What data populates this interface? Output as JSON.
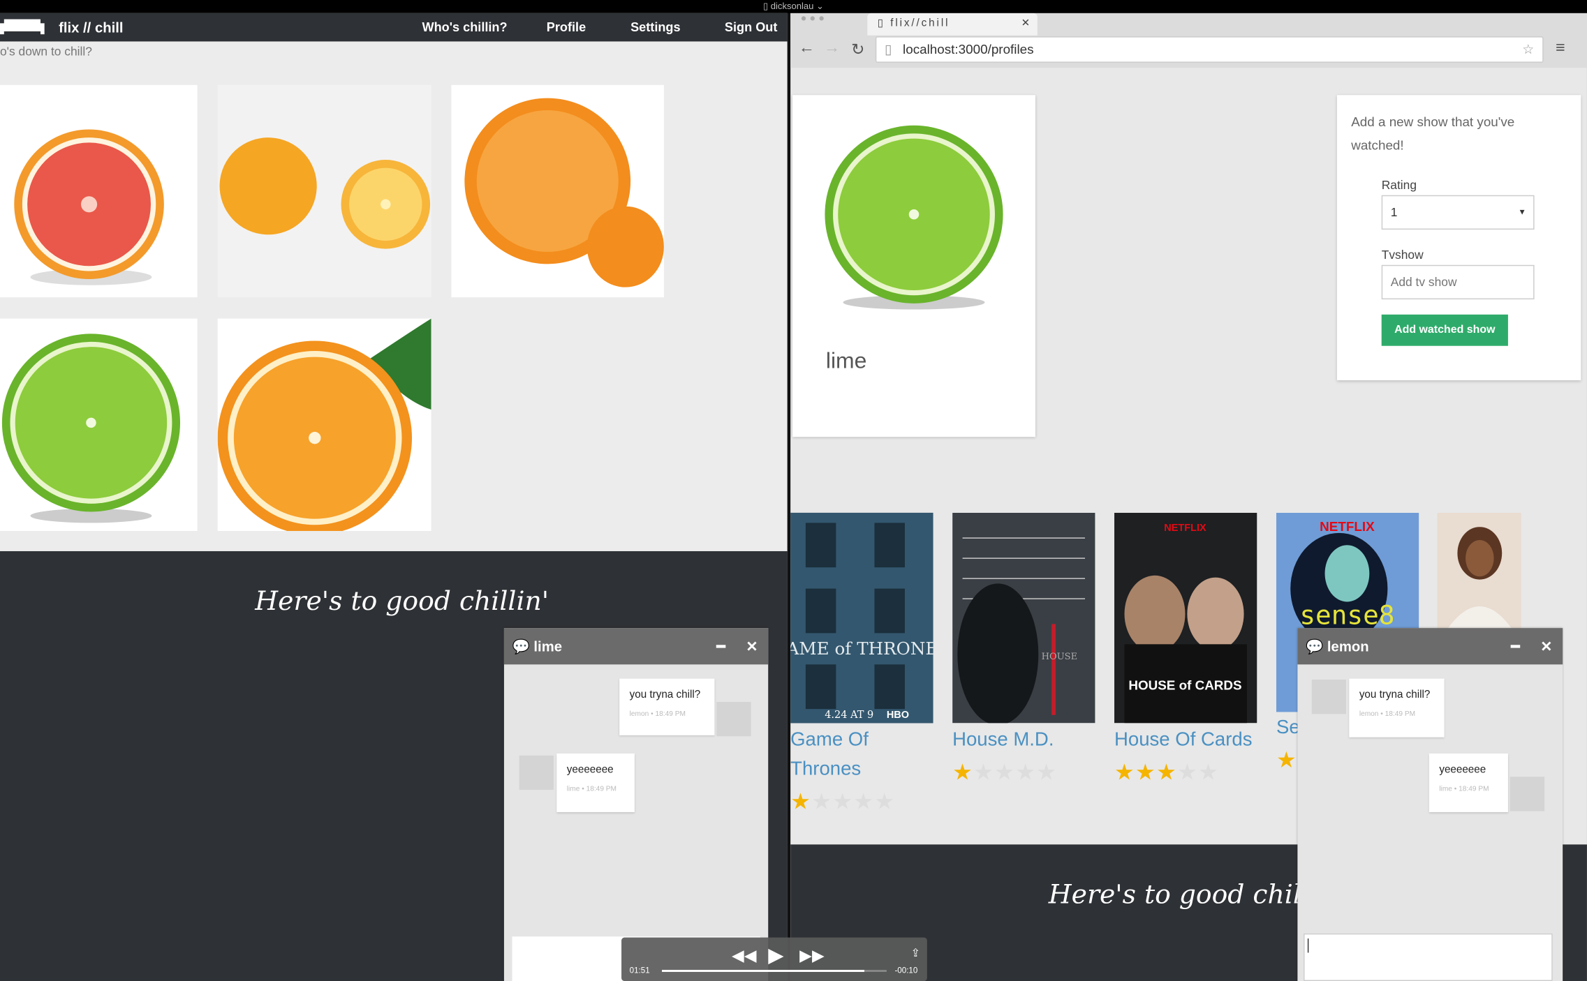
{
  "os_bar": {
    "user": "dicksonlau"
  },
  "left_app": {
    "brand": "flix // chill",
    "nav": [
      "Who's chillin?",
      "Profile",
      "Settings",
      "Sign Out"
    ],
    "subtitle": "o's down to chill?",
    "footer_text": "Here's to good chillin'"
  },
  "chat_lime": {
    "name": "lime",
    "messages": [
      {
        "text": "you tryna chill?",
        "meta": "lemon • 18:49 PM",
        "side": "right"
      },
      {
        "text": "yeeeeeee",
        "meta": "lime • 18:49 PM",
        "side": "left"
      }
    ]
  },
  "browser": {
    "tab_title": "flix//chill",
    "url": "localhost:3000/profiles"
  },
  "profile": {
    "name": "lime"
  },
  "form": {
    "heading": "Add a new show that you've watched!",
    "rating_label": "Rating",
    "rating_value": "1",
    "tvshow_label": "Tvshow",
    "tvshow_placeholder": "Add tv show",
    "submit_label": "Add watched show"
  },
  "shows": [
    {
      "title": "Game Of Thrones",
      "rating": 1
    },
    {
      "title": "House M.D.",
      "rating": 1
    },
    {
      "title": "House Of Cards",
      "rating": 3
    },
    {
      "title": "Se",
      "rating": 1
    }
  ],
  "poster_text": {
    "got": "GAME of THRONES",
    "got_date": "4.24 AT 9",
    "got_net": "HBO",
    "house": "HOUSE",
    "hoc_net": "NETFLIX",
    "hoc": "HOUSE of CARDS",
    "s8_net": "NETFLIX",
    "s8": "sense8"
  },
  "chat_lemon": {
    "name": "lemon",
    "messages": [
      {
        "text": "you tryna chill?",
        "meta": "lemon • 18:49 PM",
        "side": "left"
      },
      {
        "text": "yeeeeeee",
        "meta": "lime • 18:49 PM",
        "side": "right"
      }
    ]
  },
  "right_footer_text": "Here's to good chill",
  "media": {
    "elapsed": "01:51",
    "remaining": "-00:10",
    "progress": 0.9
  },
  "colors": {
    "dark": "#2e3135",
    "accent": "#2eab6a",
    "link": "#4a90c2",
    "star": "#f5b400"
  }
}
